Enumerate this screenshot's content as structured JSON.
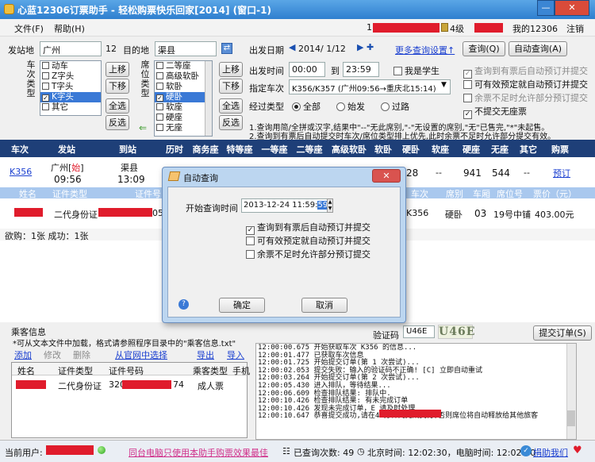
{
  "window": {
    "title": "心蓝12306订票助手 - 轻松购票快乐回家[2014] (窗口-1)",
    "min": "—",
    "close": "✕"
  },
  "menu": {
    "file": "文件(F)",
    "help": "帮助(H)",
    "user_id": "1",
    "level": "4级",
    "my12306": "我的12306",
    "logout": "注销"
  },
  "search": {
    "from_label": "发站地",
    "from": "广州",
    "num12": "12",
    "to_label": "目的地",
    "to": "渠县",
    "date_label": "出发日期",
    "date": "2014/ 1/12",
    "more": "更多查询设置↑",
    "query": "查询(Q)",
    "auto_query": "自动查询(A)",
    "train_type_label": "车次类型",
    "train_types": [
      {
        "t": "动车",
        "c": false,
        "s": false
      },
      {
        "t": "Z字头",
        "c": false,
        "s": false
      },
      {
        "t": "T字头",
        "c": false,
        "s": false
      },
      {
        "t": "K字头",
        "c": true,
        "s": true
      },
      {
        "t": "其它",
        "c": false,
        "s": false
      }
    ],
    "seat_type_label": "席位类型",
    "seat_types": [
      {
        "t": "二等座",
        "c": false,
        "s": false
      },
      {
        "t": "高级软卧",
        "c": false,
        "s": false
      },
      {
        "t": "软卧",
        "c": false,
        "s": false
      },
      {
        "t": "硬卧",
        "c": true,
        "s": true
      },
      {
        "t": "软座",
        "c": false,
        "s": false
      },
      {
        "t": "硬座",
        "c": false,
        "s": false
      },
      {
        "t": "无座",
        "c": false,
        "s": false
      }
    ],
    "up": "上移",
    "down": "下移",
    "all": "全选",
    "invert": "反选",
    "time_label": "出发时间",
    "time_from": "00:00",
    "time_to_label": "到",
    "time_to": "23:59",
    "student": "我是学生",
    "train_label": "指定车次",
    "train_value": "K356/K357 (广州09:56→重庆北15:14)",
    "via_label": "经过类型",
    "via": [
      "全部",
      "始发",
      "过路"
    ],
    "opts": [
      {
        "t": "查询到有票后自动预订并提交",
        "c": true,
        "g": true
      },
      {
        "t": "可有效预定就自动预订并提交",
        "c": false,
        "g": false
      },
      {
        "t": "余票不足时允许部分预订提交",
        "c": false,
        "g": true
      },
      {
        "t": "不提交无座票",
        "c": true,
        "g": false
      }
    ],
    "note1": "1.查询用简/全拼或汉字,结果中\"--\"无此席别,\"-\"无设置的席别,\"无\"已售完,\"*\"未起售。",
    "note2": "2.查询到有票后自动提交时车次/席位类型排上优先,此时余票不足时允许部分提交有效。"
  },
  "train_table": {
    "headers": [
      "车次",
      "发站",
      "到站",
      "历时",
      "商务座",
      "特等座",
      "一等座",
      "二等座",
      "高级软卧",
      "软卧",
      "硬卧",
      "软座",
      "硬座",
      "无座",
      "其它",
      "购票"
    ],
    "row": {
      "train": "K356",
      "from": "广州",
      "from_tag": "始",
      "from_time": "09:56",
      "to": "渠县",
      "to_time": "13:09",
      "hard_sleeper": "28",
      "soft_seat": "--",
      "hard_seat": "941",
      "no_seat": "544",
      "other": "--",
      "book": "预订"
    }
  },
  "passenger_table": {
    "headers": [
      "姓名",
      "证件类型",
      "证件号",
      "车次",
      "席别",
      "车厢",
      "席位号",
      "票价（元）"
    ],
    "row": {
      "id_type": "二代身份证",
      "id_tail": "05",
      "train": "K356",
      "seat": "硬卧",
      "car": "03",
      "seat_no": "19号中铺",
      "price": "403.00元"
    }
  },
  "stats": "欲购：1张  成功：1张",
  "dialog": {
    "title": "自动查询",
    "start_label": "开始查询时间",
    "start_value": "2013-12-24 11:59:",
    "start_sec": "59",
    "opts": [
      {
        "t": "查询到有票后自动预订并提交",
        "c": true
      },
      {
        "t": "可有效预定就自动预订并提交",
        "c": false
      },
      {
        "t": "余票不足时允许部分预订提交",
        "c": false
      }
    ],
    "ok": "确定",
    "cancel": "取消",
    "help": "?"
  },
  "passenger_info": {
    "title": "乘客信息",
    "note": "*可从文本文件中加载，格式请参照程序目录中的\"乘客信息.txt\"",
    "add": "添加",
    "edit": "修改",
    "del": "删除",
    "pick": "从官网中选择",
    "export": "导出",
    "import": "导入",
    "headers": [
      "姓名",
      "证件类型",
      "证件号码",
      "乘客类型",
      "手机"
    ],
    "row": {
      "id_type": "二代身份证",
      "id_head": "320",
      "id_tail": "74",
      "ptype": "成人票"
    }
  },
  "captcha": {
    "label": "验证码",
    "value": "U46E",
    "img": "U46E",
    "submit": "提交订单(S)"
  },
  "log": [
    "12:00:00.675 开始获取车次 K356 的信息...",
    "12:00:01.477 已获取车次信息",
    "12:00:01.725 开始提交订单(第 1 次尝试)...",
    "12:00:02.053 提交失败：输入的验证码不正确! [C] 立即自动重试",
    "12:00:03.264 开始提交订单(第 2 次尝试)...",
    "12:00:05.430 进入排队，等待结果...",
    "12:00:06.609 检查排队结果: 排队中.",
    "12:00:10.426 检查排队结果: 有未完成订单",
    "12:00:10.426 发现未完成订单，E         请及时处理",
    "12:00:10.647 恭喜提交成功,请在45分钟内完成支付,否则席位将自动释放给其他旅客"
  ],
  "status": {
    "current_user": "当前用户:",
    "ad": "同台电脑只使用本助手购票效果最佳",
    "query_count": "已查询次数: 49",
    "beijing": "北京时间: 12:02:30，电脑时间: 12:02:30",
    "donate": "捐助我们"
  }
}
